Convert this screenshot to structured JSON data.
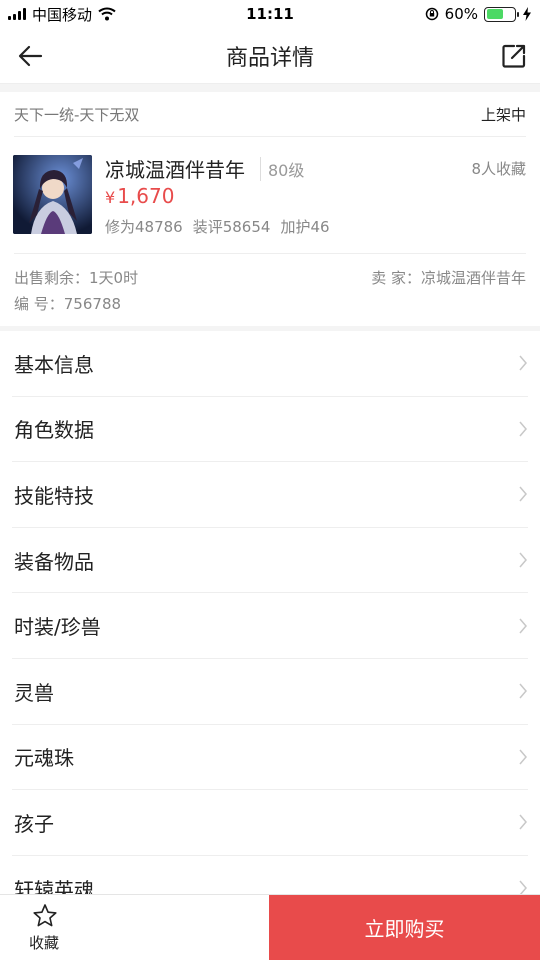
{
  "status_bar": {
    "carrier": "中国移动",
    "time": "11:11",
    "battery": "60%",
    "battery_level": 0.6
  },
  "nav": {
    "title": "商品详情"
  },
  "header": {
    "server": "天下一统-天下无双",
    "status": "上架中"
  },
  "item": {
    "name": "凉城温酒伴昔年",
    "level": "80级",
    "favorites": "8人收藏",
    "price_symbol": "¥",
    "price": "1,670",
    "stats": [
      "修为48786",
      "装评58654",
      "加护46"
    ],
    "time_left": "出售剩余：1天0时",
    "seller": "卖  家：凉城温酒伴昔年",
    "id": "编  号：756788"
  },
  "menu": [
    {
      "label": "基本信息"
    },
    {
      "label": "角色数据"
    },
    {
      "label": "技能特技"
    },
    {
      "label": "装备物品"
    },
    {
      "label": "时装/珍兽"
    },
    {
      "label": "灵兽"
    },
    {
      "label": "元魂珠"
    },
    {
      "label": "孩子"
    },
    {
      "label": "轩辕英魂"
    }
  ],
  "bottom": {
    "favorite_label": "收藏",
    "buy_label": "立即购买"
  },
  "colors": {
    "accent": "#e84b4b",
    "battery": "#4cd964"
  }
}
